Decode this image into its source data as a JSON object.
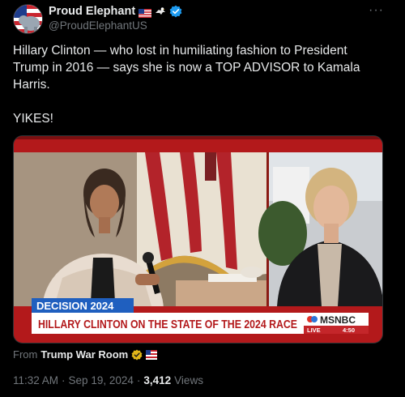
{
  "author": {
    "name": "Proud Elephant",
    "handle": "@ProudElephantUS"
  },
  "tweet": {
    "paragraphs": [
      "Hillary Clinton — who lost in humiliating fashion to President Trump in 2016 — says she is now a TOP ADVISOR to Kamala Harris.",
      "YIKES!"
    ]
  },
  "media": {
    "banner_tag": "DECISION 2024",
    "chyron": "HILLARY CLINTON ON THE STATE OF THE 2024 RACE",
    "network": "MSNBC",
    "live_label": "LIVE",
    "live_time": "4:50",
    "colors": {
      "banner_red": "#b3191b",
      "tag_blue": "#1f5fbf",
      "chyron_white": "#ffffff"
    }
  },
  "via": {
    "prefix": "From",
    "source": "Trump War Room"
  },
  "meta": {
    "time": "11:32 AM",
    "sep": "·",
    "date": "Sep 19, 2024",
    "sep2": "·",
    "views_count": "3,412",
    "views_label": "Views"
  },
  "icons": {
    "more": "more-icon",
    "verified": "verified-badge-icon",
    "flag": "us-flag-icon",
    "eagle": "eagle-icon"
  }
}
